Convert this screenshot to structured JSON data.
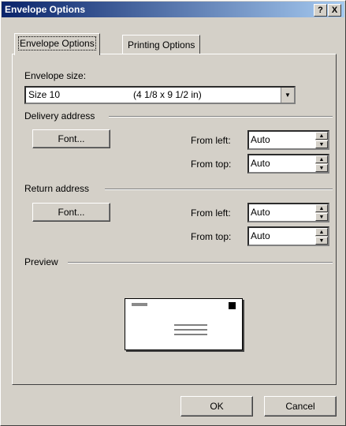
{
  "window": {
    "title": "Envelope Options",
    "help_glyph": "?",
    "close_glyph": "X"
  },
  "tabs": [
    {
      "label": "Envelope Options",
      "active": true
    },
    {
      "label": "Printing Options",
      "active": false
    }
  ],
  "envelope_size": {
    "label": "Envelope size:",
    "selected_name": "Size 10",
    "selected_dims": "(4 1/8 x 9 1/2 in)"
  },
  "delivery": {
    "heading": "Delivery address",
    "font_button": "Font...",
    "from_left_label": "From left:",
    "from_left_value": "Auto",
    "from_top_label": "From top:",
    "from_top_value": "Auto"
  },
  "return": {
    "heading": "Return address",
    "font_button": "Font...",
    "from_left_label": "From left:",
    "from_left_value": "Auto",
    "from_top_label": "From top:",
    "from_top_value": "Auto"
  },
  "preview": {
    "heading": "Preview"
  },
  "buttons": {
    "ok": "OK",
    "cancel": "Cancel"
  },
  "colors": {
    "face": "#d4d0c8",
    "title_start": "#0a246a",
    "title_end": "#a6caf0"
  }
}
